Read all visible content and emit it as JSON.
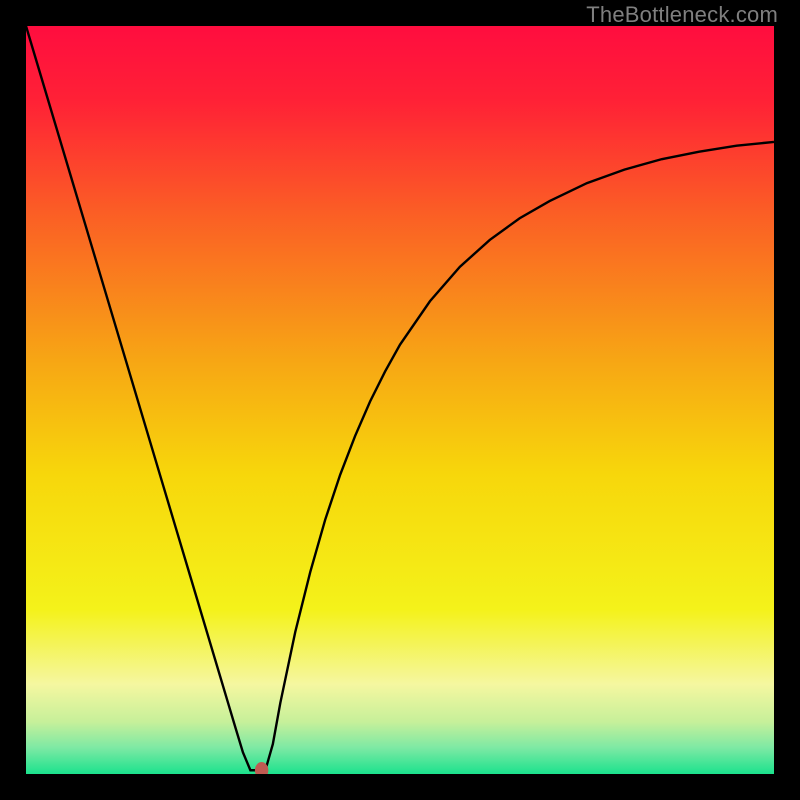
{
  "watermark": "TheBottleneck.com",
  "chart_data": {
    "type": "line",
    "title": "",
    "xlabel": "",
    "ylabel": "",
    "xlim": [
      0,
      100
    ],
    "ylim": [
      0,
      100
    ],
    "grid": false,
    "legend": false,
    "background": {
      "type": "vertical-gradient",
      "stops": [
        {
          "pos": 0.0,
          "color": "#ff0d3f"
        },
        {
          "pos": 0.1,
          "color": "#ff2136"
        },
        {
          "pos": 0.25,
          "color": "#fb5e25"
        },
        {
          "pos": 0.45,
          "color": "#f7a714"
        },
        {
          "pos": 0.6,
          "color": "#f7d70b"
        },
        {
          "pos": 0.78,
          "color": "#f4f21a"
        },
        {
          "pos": 0.88,
          "color": "#f5f7a0"
        },
        {
          "pos": 0.93,
          "color": "#c7f09a"
        },
        {
          "pos": 0.965,
          "color": "#7de9a4"
        },
        {
          "pos": 1.0,
          "color": "#1be28d"
        }
      ]
    },
    "series": [
      {
        "name": "bottleneck-curve",
        "color": "#000000",
        "stroke_width": 2.4,
        "x": [
          0,
          2,
          4,
          6,
          8,
          10,
          12,
          14,
          16,
          18,
          20,
          22,
          24,
          26,
          27,
          28,
          29,
          30,
          31,
          32,
          33,
          34,
          36,
          38,
          40,
          42,
          44,
          46,
          48,
          50,
          54,
          58,
          62,
          66,
          70,
          75,
          80,
          85,
          90,
          95,
          100
        ],
        "y": [
          100,
          93.3,
          86.6,
          79.9,
          73.2,
          66.5,
          59.8,
          53.1,
          46.4,
          39.7,
          33.0,
          26.3,
          19.6,
          12.9,
          9.55,
          6.2,
          2.9,
          0.5,
          0.5,
          0.5,
          4.0,
          9.5,
          19.0,
          27.0,
          34.0,
          40.0,
          45.2,
          49.8,
          53.8,
          57.4,
          63.2,
          67.8,
          71.4,
          74.3,
          76.6,
          79.0,
          80.8,
          82.2,
          83.2,
          84.0,
          84.5
        ]
      }
    ],
    "marker": {
      "x": 31.5,
      "y": 0.5,
      "rx": 0.9,
      "ry": 1.1,
      "color": "#c05b52"
    }
  }
}
